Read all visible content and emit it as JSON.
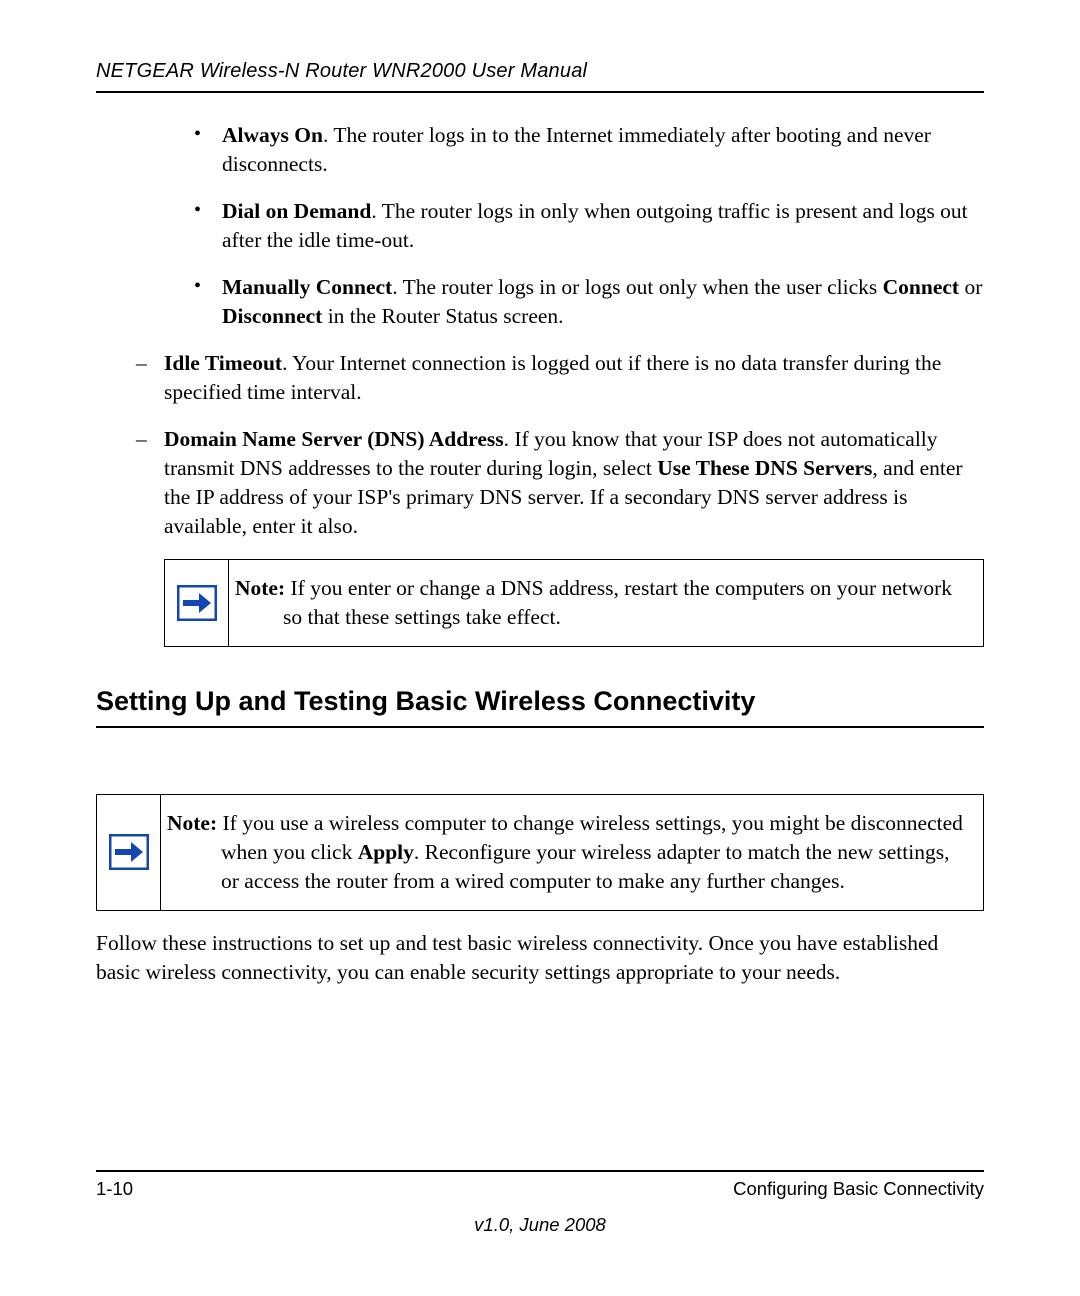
{
  "header": {
    "title": "NETGEAR Wireless-N Router WNR2000 User Manual"
  },
  "bullets": {
    "always_on": {
      "label": "Always On",
      "text": ". The router logs in to the Internet immediately after booting and never disconnects."
    },
    "dial_on_demand": {
      "label": "Dial on Demand",
      "text": ". The router logs in only when outgoing traffic is present and logs out after the idle time-out."
    },
    "manually_connect": {
      "label": "Manually Connect",
      "pre": ". The router logs in or logs out only when the user clicks ",
      "connect": "Connect",
      "mid": " or ",
      "disconnect": "Disconnect",
      "post": " in the Router Status screen."
    }
  },
  "dashes": {
    "idle_timeout": {
      "label": "Idle Timeout",
      "text": ". Your Internet connection is logged out if there is no data transfer during the specified time interval."
    },
    "dns": {
      "label": "Domain Name Server (DNS) Address",
      "pre": ". If you know that your ISP does not automatically transmit DNS addresses to the router during login, select ",
      "use_these": "Use These DNS Servers",
      "post": ", and enter the IP address of your ISP's primary DNS server. If a secondary DNS server address is available, enter it also."
    }
  },
  "note1": {
    "label": "Note:",
    "text": " If you enter or change a DNS address, restart the computers on your network so that these settings take effect."
  },
  "section_heading": "Setting Up and Testing Basic Wireless Connectivity",
  "note2": {
    "label": "Note:",
    "pre": " If you use a wireless computer to change wireless settings, you might be disconnected when you click ",
    "apply": "Apply",
    "post": ". Reconfigure your wireless adapter to match the new settings, or access the router from a wired computer to make any further changes."
  },
  "para_after": "Follow these instructions to set up and test basic wireless connectivity. Once you have established basic wireless connectivity, you can enable security settings appropriate to your needs.",
  "footer": {
    "page": "1-10",
    "section": "Configuring Basic Connectivity",
    "version": "v1.0, June 2008"
  }
}
